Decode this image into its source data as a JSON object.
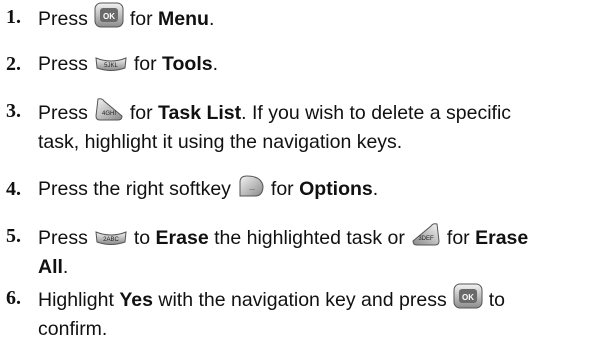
{
  "steps": [
    {
      "number": "1.",
      "parts": [
        "Press",
        "for",
        "Menu",
        "."
      ]
    },
    {
      "number": "2.",
      "parts": [
        "Press",
        "for",
        "Tools",
        "."
      ]
    },
    {
      "number": "3.",
      "parts": [
        "Press",
        "for",
        "Task List",
        ". If you wish to delete a specific",
        "task, highlight it using the navigation keys."
      ]
    },
    {
      "number": "4.",
      "parts": [
        "Press the right softkey",
        "for",
        "Options",
        "."
      ]
    },
    {
      "number": "5.",
      "parts": [
        "Press",
        "to",
        "Erase",
        "the highlighted task or",
        "for",
        "Erase",
        "All",
        "."
      ]
    },
    {
      "number": "6.",
      "parts": [
        "Highlight",
        "Yes",
        "with the navigation key and press",
        "to",
        "confirm."
      ]
    }
  ],
  "keys": {
    "ok": {
      "icon": "menu-ok-key-icon",
      "label": "OK"
    },
    "k5": {
      "icon": "key-5-jkl-icon",
      "label": "5JKL"
    },
    "k4": {
      "icon": "key-4-ghi-icon",
      "label": "4GHI"
    },
    "softkey": {
      "icon": "right-softkey-icon",
      "label": "..."
    },
    "k2": {
      "icon": "key-2-abc-icon",
      "label": "2ABC"
    },
    "k3": {
      "icon": "key-3-def-icon",
      "label": "3DEF"
    }
  }
}
